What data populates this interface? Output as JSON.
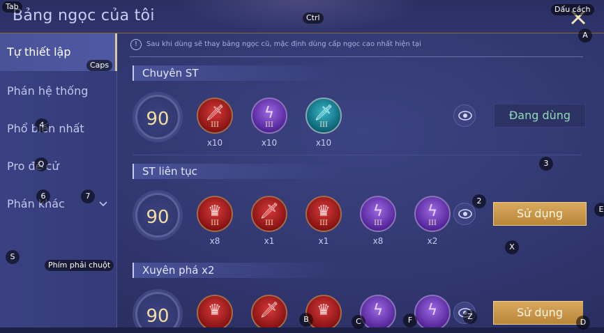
{
  "header": {
    "title": "Bảng ngọc của tôi",
    "close_icon": "close-icon"
  },
  "sidebar": {
    "items": [
      {
        "label": "Tự thiết lập",
        "active": true
      },
      {
        "label": "Phán hệ thống"
      },
      {
        "label": "Phổ biến nhất"
      },
      {
        "label": "Pro đề cử"
      },
      {
        "label": "Phán khác",
        "has_chevron": true
      }
    ]
  },
  "notice": "Sau khi dùng sẽ thay bảng ngọc cũ, mặc định dùng cấp ngọc cao nhất hiện tại",
  "sections": [
    {
      "title": "Chuyên ST",
      "level": "90",
      "gems": [
        {
          "color": "red",
          "icon": "sword-icon",
          "tier": "III",
          "count": "x10"
        },
        {
          "color": "purple",
          "icon": "lightning-icon",
          "tier": "III",
          "count": "x10"
        },
        {
          "color": "teal",
          "icon": "sword-icon",
          "tier": "III",
          "count": "x10"
        }
      ],
      "action": "Đang dùng"
    },
    {
      "title": "ST liên tục",
      "level": "90",
      "gems": [
        {
          "color": "red",
          "icon": "crown-icon",
          "tier": "III",
          "count": "x8"
        },
        {
          "color": "red",
          "icon": "sword-icon",
          "tier": "III",
          "count": "x1"
        },
        {
          "color": "red",
          "icon": "crown-icon",
          "tier": "III",
          "count": "x1"
        },
        {
          "color": "purple",
          "icon": "lightning-icon",
          "tier": "III",
          "count": "x8"
        },
        {
          "color": "purple",
          "icon": "lightning-icon",
          "tier": "III",
          "count": "x2"
        }
      ],
      "action": "Sử dụng"
    },
    {
      "title": "Xuyên phá x2",
      "level": "90",
      "gems": [
        {
          "color": "red",
          "icon": "crown-icon"
        },
        {
          "color": "red",
          "icon": "sword-icon"
        },
        {
          "color": "red",
          "icon": "crown-icon"
        },
        {
          "color": "purple",
          "icon": "lightning-icon"
        },
        {
          "color": "purple",
          "icon": "lightning-icon"
        }
      ],
      "action": "Sử dụng"
    }
  ],
  "key_hints": {
    "tab": "Tab",
    "ctrl": "Ctrl",
    "space": "Dấu cách",
    "caps": "Caps",
    "a": "A",
    "e": "E",
    "x": "X",
    "z": "Z",
    "b": "B",
    "c": "C",
    "f": "F",
    "d": "D",
    "s": "S",
    "q": "Q",
    "n2": "2",
    "n3": "3",
    "n4": "4",
    "n6": "6",
    "n7": "7",
    "right_click": "Phím phải chuột"
  },
  "colors": {
    "accent_gold": "#d9a95e",
    "using_text": "#8fdcb4",
    "level_text": "#f3df9c"
  }
}
